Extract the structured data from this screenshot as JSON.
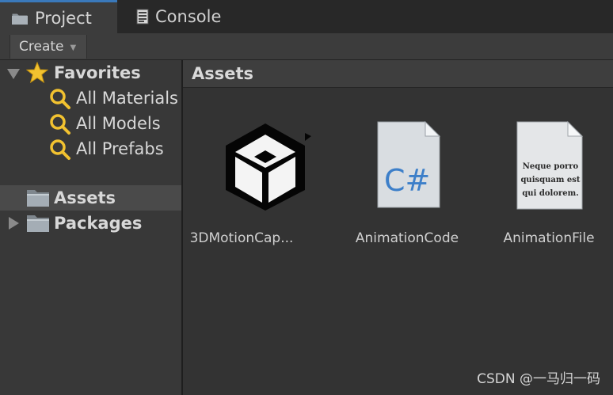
{
  "tabs": [
    {
      "label": "Project",
      "icon": "folder-icon",
      "active": true
    },
    {
      "label": "Console",
      "icon": "console-icon",
      "active": false
    }
  ],
  "toolbar": {
    "create_label": "Create",
    "create_caret": "▼"
  },
  "tree": {
    "favorites": {
      "label": "Favorites",
      "items": [
        "All Materials",
        "All Models",
        "All Prefabs"
      ]
    },
    "assets_label": "Assets",
    "packages_label": "Packages"
  },
  "content": {
    "header": "Assets",
    "assets": [
      {
        "label": "3DMotionCap...",
        "icon": "unity-logo-icon"
      },
      {
        "label": "AnimationCode",
        "icon": "csharp-file-icon",
        "glyph": "C#"
      },
      {
        "label": "AnimationFile",
        "icon": "text-file-icon",
        "preview_text": [
          "Neque porro",
          "quisquam est",
          "qui dolorem."
        ]
      }
    ]
  },
  "watermark": "CSDN @一马归一码",
  "colors": {
    "accent": "#3a79bb",
    "star": "#f2c230",
    "search": "#f2c230",
    "folder": "#9aa3ab",
    "csharp": "#3d7fc9"
  }
}
